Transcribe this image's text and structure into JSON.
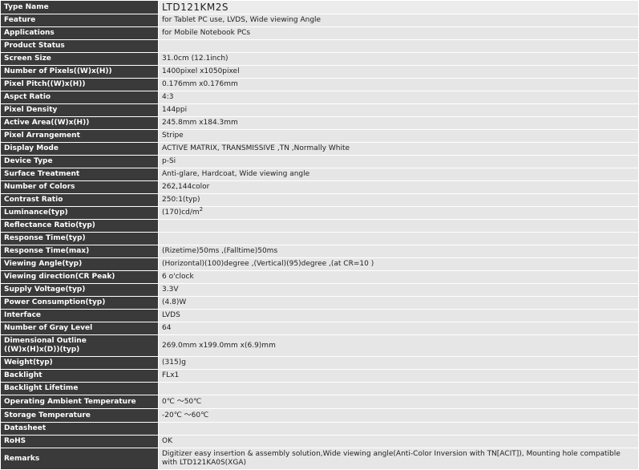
{
  "rows": [
    {
      "label": "Type Name",
      "value": "LTD121KM2S",
      "h": 17,
      "title": true
    },
    {
      "label": "Feature",
      "value": "for Tablet PC use, LVDS, Wide viewing Angle",
      "h": 16
    },
    {
      "label": "Applications",
      "value": "for Mobile Notebook PCs",
      "h": 16
    },
    {
      "label": "Product Status",
      "value": "",
      "h": 16
    },
    {
      "label": "Screen Size",
      "value": "31.0cm  (12.1inch)",
      "h": 16
    },
    {
      "label": "Number of Pixels((W)x(H))",
      "value": "1400pixel x1050pixel",
      "h": 16
    },
    {
      "label": "Pixel Pitch((W)x(H))",
      "value": "0.176mm x0.176mm",
      "h": 16
    },
    {
      "label": "Aspct Ratio",
      "value": "4:3",
      "h": 16
    },
    {
      "label": "Pixel Density",
      "value": "144ppi",
      "h": 16
    },
    {
      "label": "Active Area((W)x(H))",
      "value": "245.8mm x184.3mm",
      "h": 16
    },
    {
      "label": "Pixel Arrangement",
      "value": "Stripe",
      "h": 16
    },
    {
      "label": "Display Mode",
      "value": "ACTIVE MATRIX, TRANSMISSIVE ,TN ,Normally White",
      "h": 16
    },
    {
      "label": "Device Type",
      "value": "p-Si",
      "h": 16
    },
    {
      "label": "Surface Treatment",
      "value": "Anti-glare, Hardcoat, Wide viewing angle",
      "h": 16
    },
    {
      "label": "Number of Colors",
      "value": "262,144color",
      "h": 16
    },
    {
      "label": "Contrast Ratio",
      "value": "250:1(typ)",
      "h": 16
    },
    {
      "label": "Luminance(typ)",
      "value": "(170)cd/m",
      "sup": "2",
      "h": 16
    },
    {
      "label": "Reflectance Ratio(typ)",
      "value": "",
      "h": 16
    },
    {
      "label": "Response Time(typ)",
      "value": "",
      "h": 16
    },
    {
      "label": "Response Time(max)",
      "value": "(Rizetime)50ms ,(Falltime)50ms",
      "h": 16
    },
    {
      "label": "Viewing Angle(typ)",
      "value": "(Horizontal)(100)degree ,(Vertical)(95)degree ,(at CR=10 )",
      "h": 16
    },
    {
      "label": "Viewing direction(CR Peak)",
      "value": "6 o'clock",
      "h": 16
    },
    {
      "label": "Supply Voltage(typ)",
      "value": "3.3V",
      "h": 16
    },
    {
      "label": "Power Consumption(typ)",
      "value": "(4.8)W",
      "h": 16
    },
    {
      "label": "Interface",
      "value": "LVDS",
      "h": 16
    },
    {
      "label": "Number of Gray Level",
      "value": "64",
      "h": 16
    },
    {
      "label": "Dimensional Outline\n((W)x(H)x(D))(typ)",
      "value": "269.0mm x199.0mm x(6.9)mm",
      "h": 27
    },
    {
      "label": "Weight(typ)",
      "value": "(315)g",
      "h": 16
    },
    {
      "label": "Backlight",
      "value": "FLx1",
      "h": 16
    },
    {
      "label": "Backlight Lifetime",
      "value": "",
      "h": 16
    },
    {
      "label": "Operating Ambient Temperature",
      "value": "0℃ ～50℃",
      "h": 17
    },
    {
      "label": "Storage Temperature",
      "value": "-20℃ ～60℃",
      "h": 17
    },
    {
      "label": "Datasheet",
      "value": "",
      "h": 16
    },
    {
      "label": "RoHS",
      "value": "OK",
      "h": 16
    },
    {
      "label": "Remarks",
      "value": "Digitizer easy insertion & assembly solution,Wide viewing angle(Anti-Color Inversion with TN[ACIT]), Mounting hole compatible with LTD121KA0S(XGA)",
      "h": 27
    }
  ]
}
